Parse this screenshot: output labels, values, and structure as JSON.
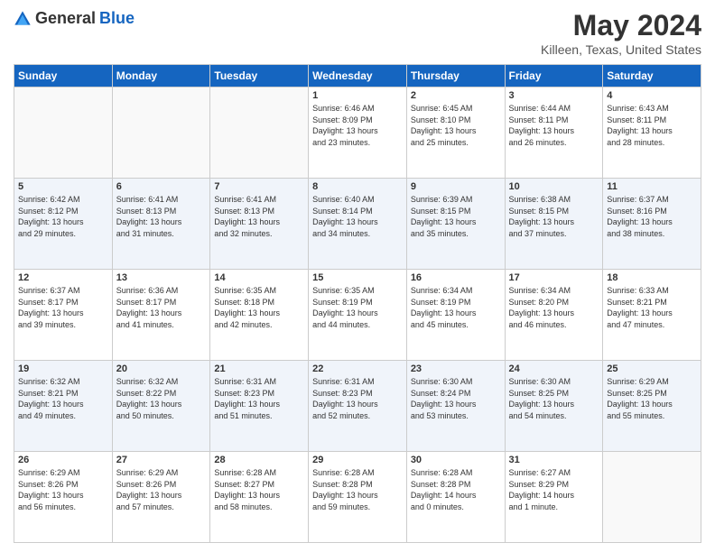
{
  "header": {
    "logo_general": "General",
    "logo_blue": "Blue",
    "title": "May 2024",
    "location": "Killeen, Texas, United States"
  },
  "days_of_week": [
    "Sunday",
    "Monday",
    "Tuesday",
    "Wednesday",
    "Thursday",
    "Friday",
    "Saturday"
  ],
  "weeks": [
    [
      {
        "day": "",
        "info": ""
      },
      {
        "day": "",
        "info": ""
      },
      {
        "day": "",
        "info": ""
      },
      {
        "day": "1",
        "info": "Sunrise: 6:46 AM\nSunset: 8:09 PM\nDaylight: 13 hours\nand 23 minutes."
      },
      {
        "day": "2",
        "info": "Sunrise: 6:45 AM\nSunset: 8:10 PM\nDaylight: 13 hours\nand 25 minutes."
      },
      {
        "day": "3",
        "info": "Sunrise: 6:44 AM\nSunset: 8:11 PM\nDaylight: 13 hours\nand 26 minutes."
      },
      {
        "day": "4",
        "info": "Sunrise: 6:43 AM\nSunset: 8:11 PM\nDaylight: 13 hours\nand 28 minutes."
      }
    ],
    [
      {
        "day": "5",
        "info": "Sunrise: 6:42 AM\nSunset: 8:12 PM\nDaylight: 13 hours\nand 29 minutes."
      },
      {
        "day": "6",
        "info": "Sunrise: 6:41 AM\nSunset: 8:13 PM\nDaylight: 13 hours\nand 31 minutes."
      },
      {
        "day": "7",
        "info": "Sunrise: 6:41 AM\nSunset: 8:13 PM\nDaylight: 13 hours\nand 32 minutes."
      },
      {
        "day": "8",
        "info": "Sunrise: 6:40 AM\nSunset: 8:14 PM\nDaylight: 13 hours\nand 34 minutes."
      },
      {
        "day": "9",
        "info": "Sunrise: 6:39 AM\nSunset: 8:15 PM\nDaylight: 13 hours\nand 35 minutes."
      },
      {
        "day": "10",
        "info": "Sunrise: 6:38 AM\nSunset: 8:15 PM\nDaylight: 13 hours\nand 37 minutes."
      },
      {
        "day": "11",
        "info": "Sunrise: 6:37 AM\nSunset: 8:16 PM\nDaylight: 13 hours\nand 38 minutes."
      }
    ],
    [
      {
        "day": "12",
        "info": "Sunrise: 6:37 AM\nSunset: 8:17 PM\nDaylight: 13 hours\nand 39 minutes."
      },
      {
        "day": "13",
        "info": "Sunrise: 6:36 AM\nSunset: 8:17 PM\nDaylight: 13 hours\nand 41 minutes."
      },
      {
        "day": "14",
        "info": "Sunrise: 6:35 AM\nSunset: 8:18 PM\nDaylight: 13 hours\nand 42 minutes."
      },
      {
        "day": "15",
        "info": "Sunrise: 6:35 AM\nSunset: 8:19 PM\nDaylight: 13 hours\nand 44 minutes."
      },
      {
        "day": "16",
        "info": "Sunrise: 6:34 AM\nSunset: 8:19 PM\nDaylight: 13 hours\nand 45 minutes."
      },
      {
        "day": "17",
        "info": "Sunrise: 6:34 AM\nSunset: 8:20 PM\nDaylight: 13 hours\nand 46 minutes."
      },
      {
        "day": "18",
        "info": "Sunrise: 6:33 AM\nSunset: 8:21 PM\nDaylight: 13 hours\nand 47 minutes."
      }
    ],
    [
      {
        "day": "19",
        "info": "Sunrise: 6:32 AM\nSunset: 8:21 PM\nDaylight: 13 hours\nand 49 minutes."
      },
      {
        "day": "20",
        "info": "Sunrise: 6:32 AM\nSunset: 8:22 PM\nDaylight: 13 hours\nand 50 minutes."
      },
      {
        "day": "21",
        "info": "Sunrise: 6:31 AM\nSunset: 8:23 PM\nDaylight: 13 hours\nand 51 minutes."
      },
      {
        "day": "22",
        "info": "Sunrise: 6:31 AM\nSunset: 8:23 PM\nDaylight: 13 hours\nand 52 minutes."
      },
      {
        "day": "23",
        "info": "Sunrise: 6:30 AM\nSunset: 8:24 PM\nDaylight: 13 hours\nand 53 minutes."
      },
      {
        "day": "24",
        "info": "Sunrise: 6:30 AM\nSunset: 8:25 PM\nDaylight: 13 hours\nand 54 minutes."
      },
      {
        "day": "25",
        "info": "Sunrise: 6:29 AM\nSunset: 8:25 PM\nDaylight: 13 hours\nand 55 minutes."
      }
    ],
    [
      {
        "day": "26",
        "info": "Sunrise: 6:29 AM\nSunset: 8:26 PM\nDaylight: 13 hours\nand 56 minutes."
      },
      {
        "day": "27",
        "info": "Sunrise: 6:29 AM\nSunset: 8:26 PM\nDaylight: 13 hours\nand 57 minutes."
      },
      {
        "day": "28",
        "info": "Sunrise: 6:28 AM\nSunset: 8:27 PM\nDaylight: 13 hours\nand 58 minutes."
      },
      {
        "day": "29",
        "info": "Sunrise: 6:28 AM\nSunset: 8:28 PM\nDaylight: 13 hours\nand 59 minutes."
      },
      {
        "day": "30",
        "info": "Sunrise: 6:28 AM\nSunset: 8:28 PM\nDaylight: 14 hours\nand 0 minutes."
      },
      {
        "day": "31",
        "info": "Sunrise: 6:27 AM\nSunset: 8:29 PM\nDaylight: 14 hours\nand 1 minute."
      },
      {
        "day": "",
        "info": ""
      }
    ]
  ]
}
